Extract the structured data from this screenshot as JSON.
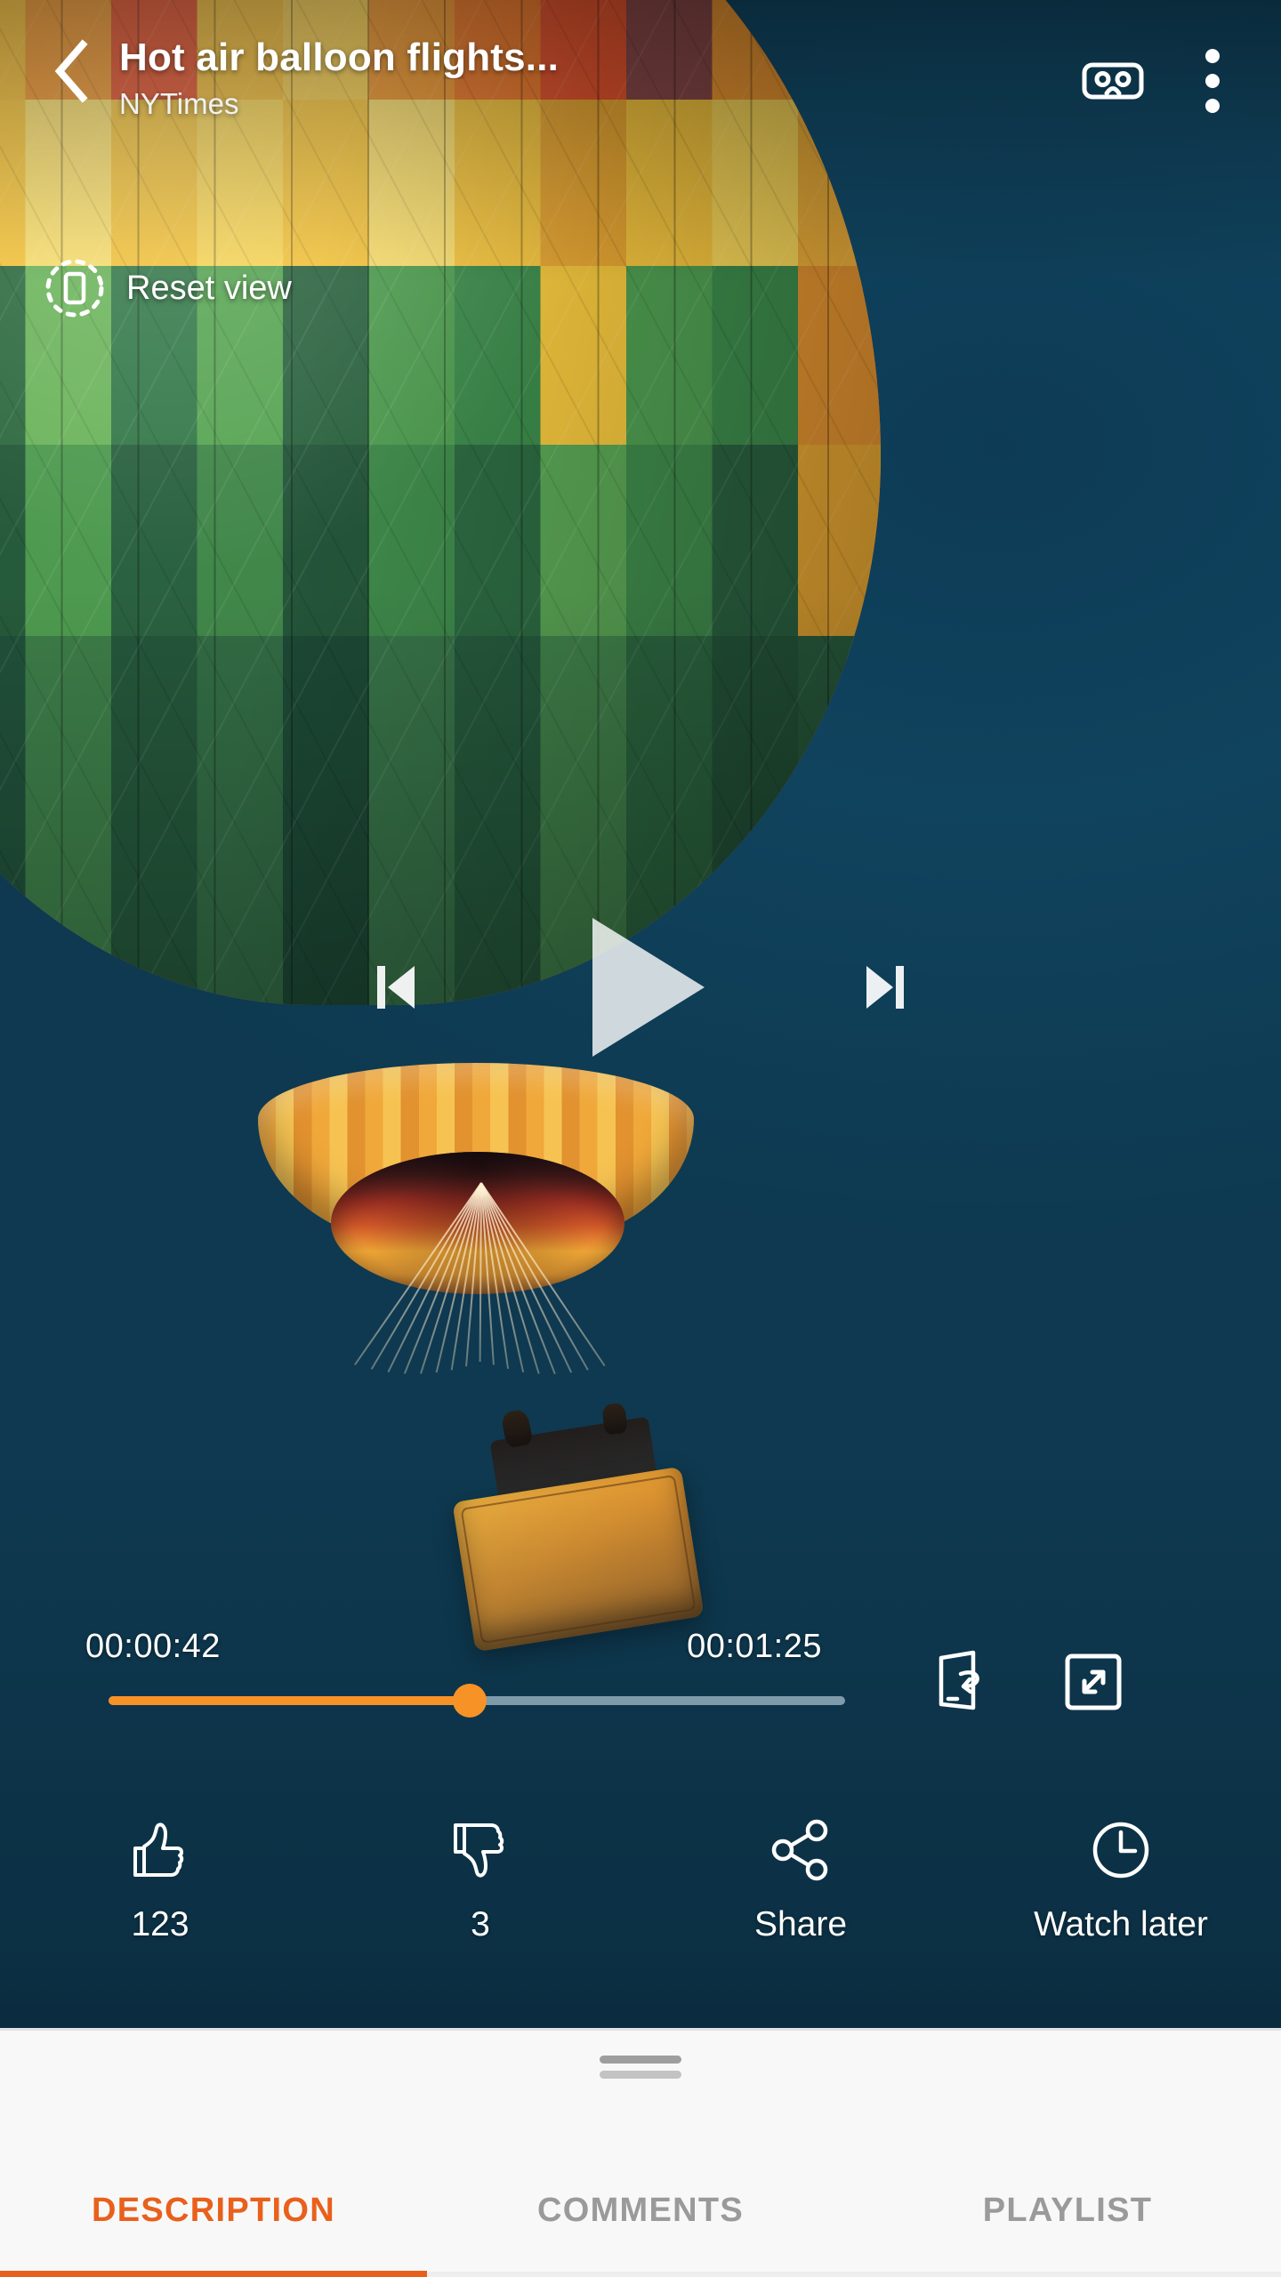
{
  "header": {
    "back_icon": "chevron-left-icon",
    "title": "Hot air balloon flights...",
    "channel": "NYTimes",
    "vr_icon": "cardboard-vr-icon",
    "overflow_icon": "more-vertical-icon"
  },
  "overlay": {
    "reset_view_label": "Reset view",
    "reset_view_icon": "reset-view-icon"
  },
  "transport": {
    "previous_icon": "skip-previous-icon",
    "play_icon": "play-icon",
    "next_icon": "skip-next-icon"
  },
  "player": {
    "current_time": "00:00:42",
    "total_time": "00:01:25",
    "progress_percent": 49,
    "rotate_icon": "screen-rotate-icon",
    "fullscreen_icon": "fullscreen-expand-icon"
  },
  "actions": [
    {
      "name": "like",
      "icon": "thumb-up-icon",
      "label": "123"
    },
    {
      "name": "dislike",
      "icon": "thumb-down-icon",
      "label": "3"
    },
    {
      "name": "share",
      "icon": "share-icon",
      "label": "Share"
    },
    {
      "name": "watch-later",
      "icon": "clock-icon",
      "label": "Watch later"
    }
  ],
  "sheet": {
    "handle_icon": "drag-handle-icon",
    "tabs": [
      {
        "label": "DESCRIPTION",
        "active": true
      },
      {
        "label": "COMMENTS",
        "active": false
      },
      {
        "label": "PLAYLIST",
        "active": false
      }
    ]
  },
  "colors": {
    "accent_orange": "#f79226",
    "tab_active": "#e8601c",
    "video_background": "#0f3d57",
    "sheet_background": "#f8f8f8",
    "progress_remaining": "#7f9aab"
  }
}
